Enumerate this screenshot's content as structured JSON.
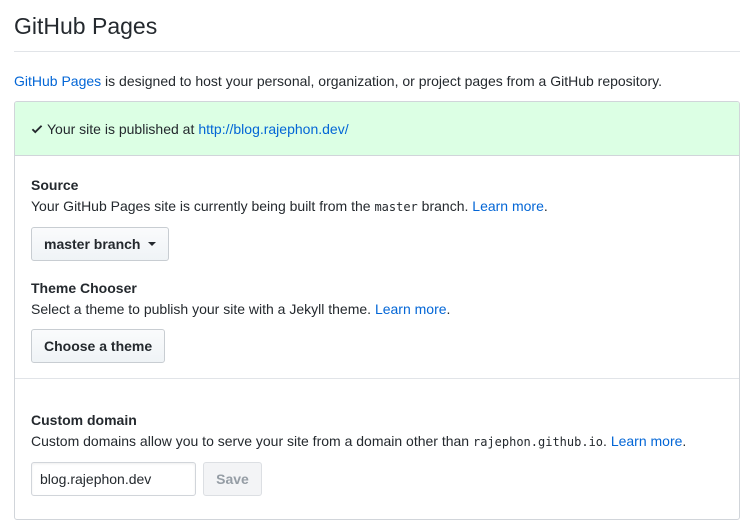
{
  "page": {
    "title": "GitHub Pages",
    "intro_link": "GitHub Pages",
    "intro_text": " is designed to host your personal, organization, or project pages from a GitHub repository."
  },
  "flash": {
    "text": "Your site is published at ",
    "url": "http://blog.rajephon.dev/",
    "bg_color": "#dcffe4"
  },
  "source": {
    "heading": "Source",
    "desc_before": "Your GitHub Pages site is currently being built from the ",
    "branch_code": "master",
    "desc_after": " branch. ",
    "learn_more": "Learn more",
    "period": ".",
    "dropdown_label": "master branch"
  },
  "theme": {
    "heading": "Theme Chooser",
    "desc": "Select a theme to publish your site with a Jekyll theme. ",
    "learn_more": "Learn more",
    "period": ".",
    "button_label": "Choose a theme"
  },
  "custom_domain": {
    "heading": "Custom domain",
    "desc_before": "Custom domains allow you to serve your site from a domain other than ",
    "domain_code": "rajephon.github.io",
    "desc_after": ". ",
    "learn_more": "Learn more",
    "period": ".",
    "input_value": "blog.rajephon.dev",
    "save_label": "Save"
  },
  "colors": {
    "link": "#0366d6",
    "text": "#24292e",
    "border": "#d1d5da"
  }
}
